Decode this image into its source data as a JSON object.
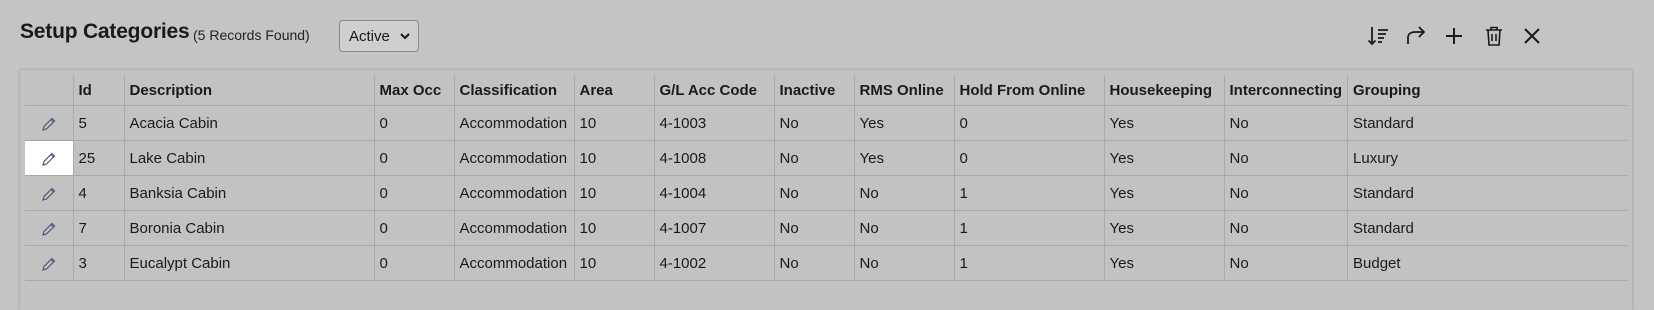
{
  "header": {
    "title": "Setup Categories",
    "record_count": "(5 Records Found)",
    "status_filter": "Active"
  },
  "toolbar": {
    "icons": [
      "sort-icon",
      "share-icon",
      "add-icon",
      "delete-icon",
      "close-icon"
    ]
  },
  "table": {
    "columns": [
      "Id",
      "Description",
      "Max Occ",
      "Classification",
      "Area",
      "G/L Acc Code",
      "Inactive",
      "RMS Online",
      "Hold From Online",
      "Housekeeping",
      "Interconnecting",
      "Grouping"
    ],
    "rows": [
      {
        "id": "5",
        "description": "Acacia Cabin",
        "max_occ": "0",
        "classification": "Accommodation",
        "area": "10",
        "gl": "4-1003",
        "inactive": "No",
        "rms_online": "Yes",
        "hold": "0",
        "housekeeping": "Yes",
        "interconnecting": "No",
        "grouping": "Standard"
      },
      {
        "id": "25",
        "description": "Lake Cabin",
        "max_occ": "0",
        "classification": "Accommodation",
        "area": "10",
        "gl": "4-1008",
        "inactive": "No",
        "rms_online": "Yes",
        "hold": "0",
        "housekeeping": "Yes",
        "interconnecting": "No",
        "grouping": "Luxury"
      },
      {
        "id": "4",
        "description": "Banksia Cabin",
        "max_occ": "0",
        "classification": "Accommodation",
        "area": "10",
        "gl": "4-1004",
        "inactive": "No",
        "rms_online": "No",
        "hold": "1",
        "housekeeping": "Yes",
        "interconnecting": "No",
        "grouping": "Standard"
      },
      {
        "id": "7",
        "description": "Boronia Cabin",
        "max_occ": "0",
        "classification": "Accommodation",
        "area": "10",
        "gl": "4-1007",
        "inactive": "No",
        "rms_online": "No",
        "hold": "1",
        "housekeeping": "Yes",
        "interconnecting": "No",
        "grouping": "Standard"
      },
      {
        "id": "3",
        "description": "Eucalypt Cabin",
        "max_occ": "0",
        "classification": "Accommodation",
        "area": "10",
        "gl": "4-1002",
        "inactive": "No",
        "rms_online": "No",
        "hold": "1",
        "housekeeping": "Yes",
        "interconnecting": "No",
        "grouping": "Budget"
      }
    ]
  },
  "colors": {
    "background": "#c4c4c4",
    "selected_cell": "#ffffff",
    "pencil": "#4a5a7a"
  }
}
